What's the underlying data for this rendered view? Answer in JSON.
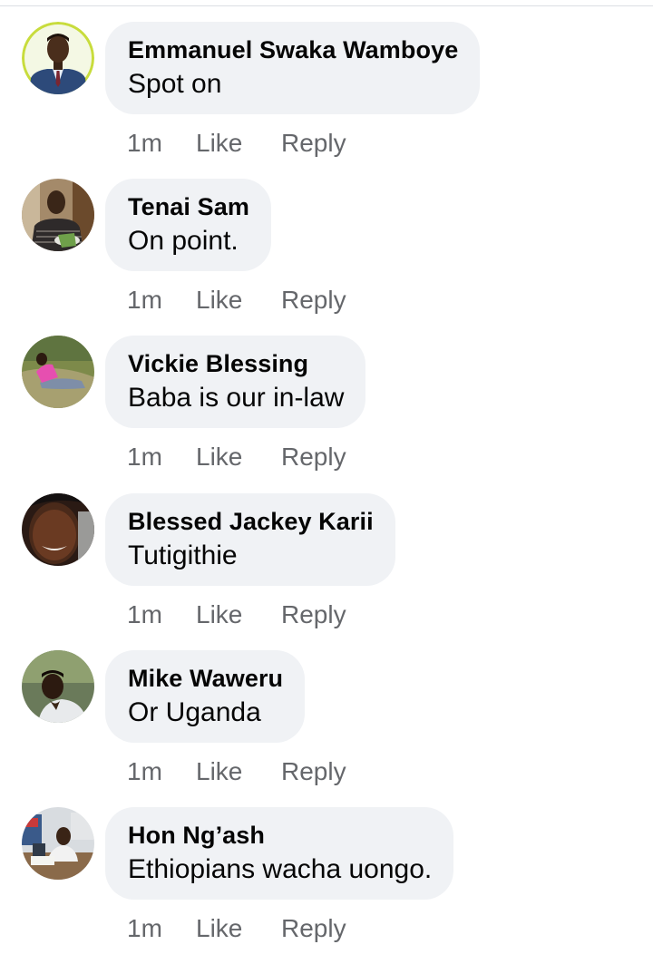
{
  "comments": [
    {
      "author": "Emmanuel Swaka Wamboye",
      "text": "Spot on",
      "time": "1m",
      "like": "Like",
      "reply": "Reply"
    },
    {
      "author": "Tenai Sam",
      "text": "On point.",
      "time": "1m",
      "like": "Like",
      "reply": "Reply"
    },
    {
      "author": "Vickie Blessing",
      "text": "Baba is our in-law",
      "time": "1m",
      "like": "Like",
      "reply": "Reply"
    },
    {
      "author": "Blessed Jackey Karii",
      "text": "Tutigithie",
      "time": "1m",
      "like": "Like",
      "reply": "Reply"
    },
    {
      "author": "Mike Waweru",
      "text": "Or Uganda",
      "time": "1m",
      "like": "Like",
      "reply": "Reply"
    },
    {
      "author": "Hon Ng’ash",
      "text": "Ethiopians wacha uongo.",
      "time": "1m",
      "like": "Like",
      "reply": "Reply"
    }
  ],
  "colors": {
    "bubble_background": "#f0f2f5",
    "author_text": "#050505",
    "secondary_text": "#65676b"
  }
}
